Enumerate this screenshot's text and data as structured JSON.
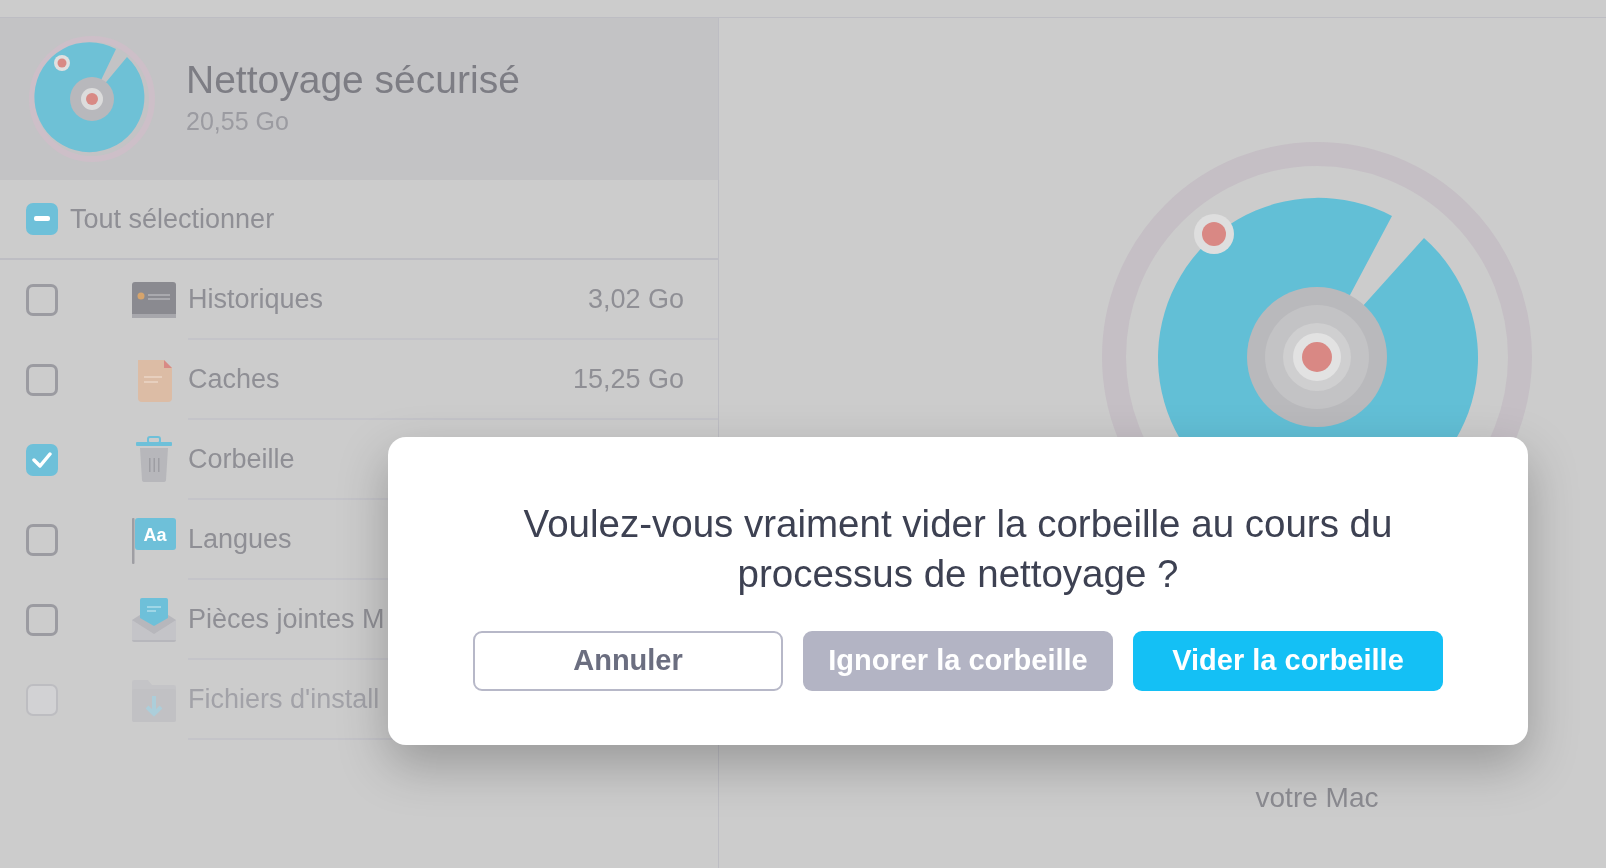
{
  "header": {
    "title": "Nettoyage sécurisé",
    "size": "20,55 Go"
  },
  "select_all": {
    "label": "Tout sélectionner",
    "indeterminate": true
  },
  "items": [
    {
      "kind": "history",
      "name": "Historiques",
      "size": "3,02 Go",
      "checked": false,
      "disabled": false
    },
    {
      "kind": "cache",
      "name": "Caches",
      "size": "15,25 Go",
      "checked": false,
      "disabled": false
    },
    {
      "kind": "trash",
      "name": "Corbeille",
      "checked": true,
      "disabled": false
    },
    {
      "kind": "language",
      "name": "Langues",
      "icon_text": "Aa",
      "checked": false,
      "disabled": false
    },
    {
      "kind": "mail",
      "name": "Pièces jointes M",
      "checked": false,
      "disabled": false
    },
    {
      "kind": "installer",
      "name": "Fichiers d'install",
      "checked": false,
      "disabled": true
    }
  ],
  "right_panel": {
    "caption": "votre Mac"
  },
  "dialog": {
    "message": "Voulez-vous vraiment vider la corbeille au cours du processus de nettoyage ?",
    "buttons": [
      {
        "label": "Annuler",
        "kind": "outline"
      },
      {
        "label": "Ignorer la corbeille",
        "kind": "secondary"
      },
      {
        "label": "Vider la corbeille",
        "kind": "primary"
      }
    ]
  }
}
